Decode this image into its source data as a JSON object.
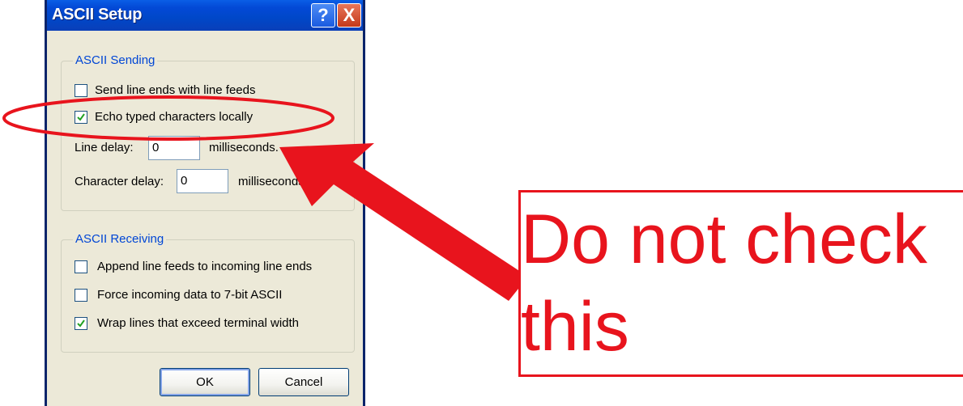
{
  "dialog": {
    "title": "ASCII Setup",
    "help_glyph": "?",
    "close_glyph": "X"
  },
  "sending": {
    "legend": "ASCII Sending",
    "send_line_ends": {
      "label": "Send line ends with line feeds",
      "checked": false
    },
    "echo_typed": {
      "label": "Echo typed characters locally",
      "checked": true
    },
    "line_delay": {
      "label": "Line delay:",
      "value": "0",
      "unit": "milliseconds."
    },
    "char_delay": {
      "label": "Character delay:",
      "value": "0",
      "unit": "milliseconds."
    }
  },
  "receiving": {
    "legend": "ASCII Receiving",
    "append_line_feeds": {
      "label": "Append line feeds to incoming line ends",
      "checked": false
    },
    "force_7bit": {
      "label": "Force incoming data to 7-bit ASCII",
      "checked": false
    },
    "wrap_lines": {
      "label": "Wrap lines that exceed terminal width",
      "checked": true
    }
  },
  "buttons": {
    "ok": "OK",
    "cancel": "Cancel"
  },
  "annotation": {
    "line1": "Do not check",
    "line2": "this",
    "color": "#e8141d"
  },
  "colors": {
    "titlebar": "#0047c8",
    "legend": "#0046d5",
    "dialog_bg": "#ece9d8"
  }
}
